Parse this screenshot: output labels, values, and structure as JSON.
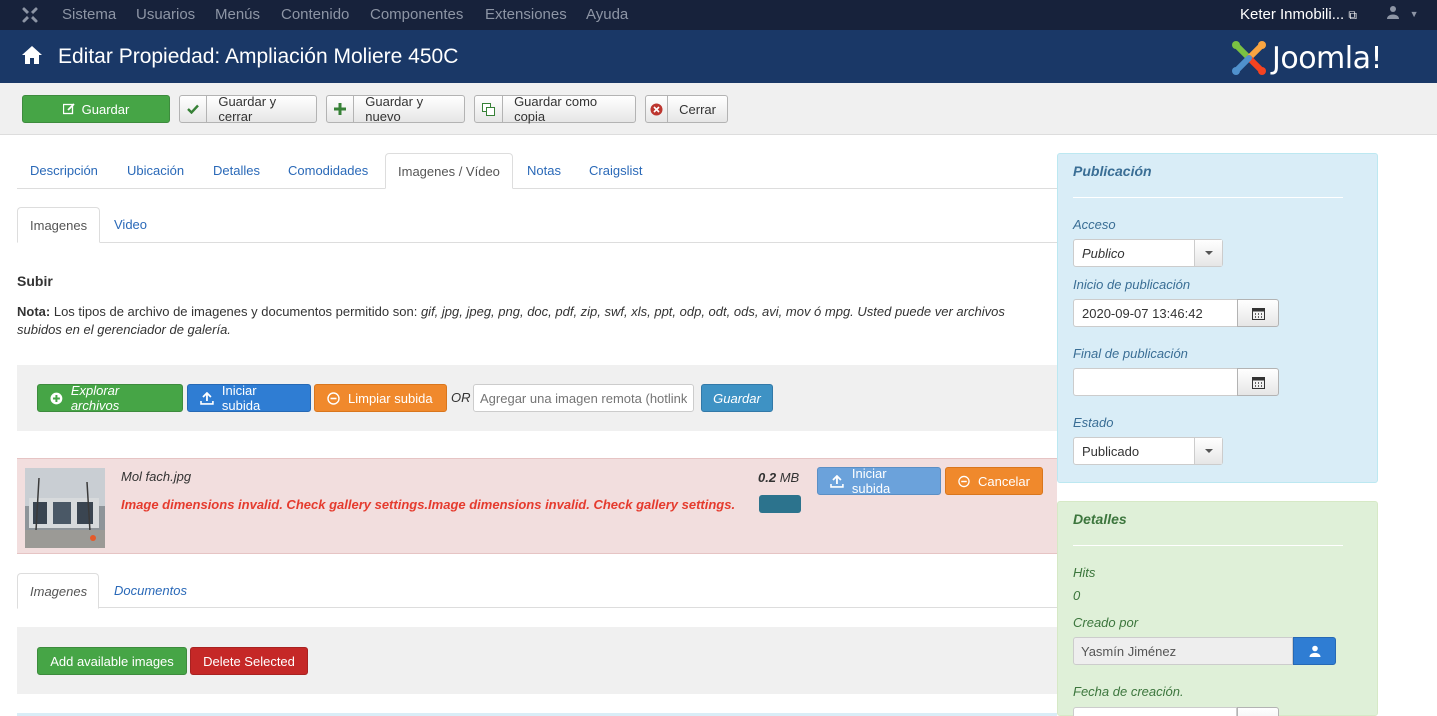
{
  "navbar": {
    "menu": [
      "Sistema",
      "Usuarios",
      "Menús",
      "Contenido",
      "Componentes",
      "Extensiones",
      "Ayuda"
    ],
    "site_name": "Keter Inmobili...",
    "joomla_icon": "joomla-icon",
    "user_icon": "user-icon"
  },
  "header": {
    "title": "Editar Propiedad: Ampliación Moliere 450C",
    "logo_text": "Joomla!"
  },
  "toolbar": {
    "guardar": "Guardar",
    "guardar_cerrar": "Guardar y cerrar",
    "guardar_nuevo": "Guardar y nuevo",
    "guardar_copia": "Guardar como copia",
    "cerrar": "Cerrar"
  },
  "tabs": [
    "Descripción",
    "Ubicación",
    "Detalles",
    "Comodidades",
    "Imagenes / Vídeo",
    "Notas",
    "Craigslist"
  ],
  "subtabs": [
    "Imagenes",
    "Video"
  ],
  "upload": {
    "title": "Subir",
    "note_label": "Nota:",
    "note_text": "Los tipos de archivo de imagenes y documentos permitido son:",
    "note_types": "gif, jpg, jpeg, png, doc, pdf, zip, swf, xls, ppt, odp, odt, ods, avi, mov ó mpg. Usted puede ver archivos subidos en el gerenciador de galería.",
    "explorar": "Explorar archivos",
    "iniciar": "Iniciar subida",
    "limpiar": "Limpiar subida",
    "or": "OR",
    "remote_placeholder": "Agregar una imagen remota (hotlink)",
    "guardar": "Guardar"
  },
  "file": {
    "name": "Mol fach.jpg",
    "error": "Image dimensions invalid. Check gallery settings.Image dimensions invalid. Check gallery settings.",
    "size": "0.2",
    "size_unit": "MB",
    "iniciar": "Iniciar subida",
    "cancelar": "Cancelar",
    "progress": 0
  },
  "gallery": {
    "tabs": [
      "Imagenes",
      "Documentos"
    ],
    "add": "Add available images",
    "delete": "Delete Selected"
  },
  "publicacion": {
    "title": "Publicación",
    "acceso_label": "Acceso",
    "acceso_value": "Publico",
    "inicio_label": "Inicio de publicación",
    "inicio_value": "2020-09-07 13:46:42",
    "final_label": "Final de publicación",
    "final_value": "",
    "estado_label": "Estado",
    "estado_value": "Publicado"
  },
  "detalles": {
    "title": "Detalles",
    "hits_label": "Hits",
    "hits_value": "0",
    "creado_label": "Creado por",
    "creado_value": "Yasmín Jiménez",
    "fecha_label": "Fecha de creación."
  },
  "colors": {
    "navbar": "#17223b",
    "titlebar": "#1a3867",
    "success": "#46a546",
    "primary": "#2f7dd3",
    "warning": "#f0892c",
    "danger": "#c52827",
    "info": "#3e92c4"
  }
}
